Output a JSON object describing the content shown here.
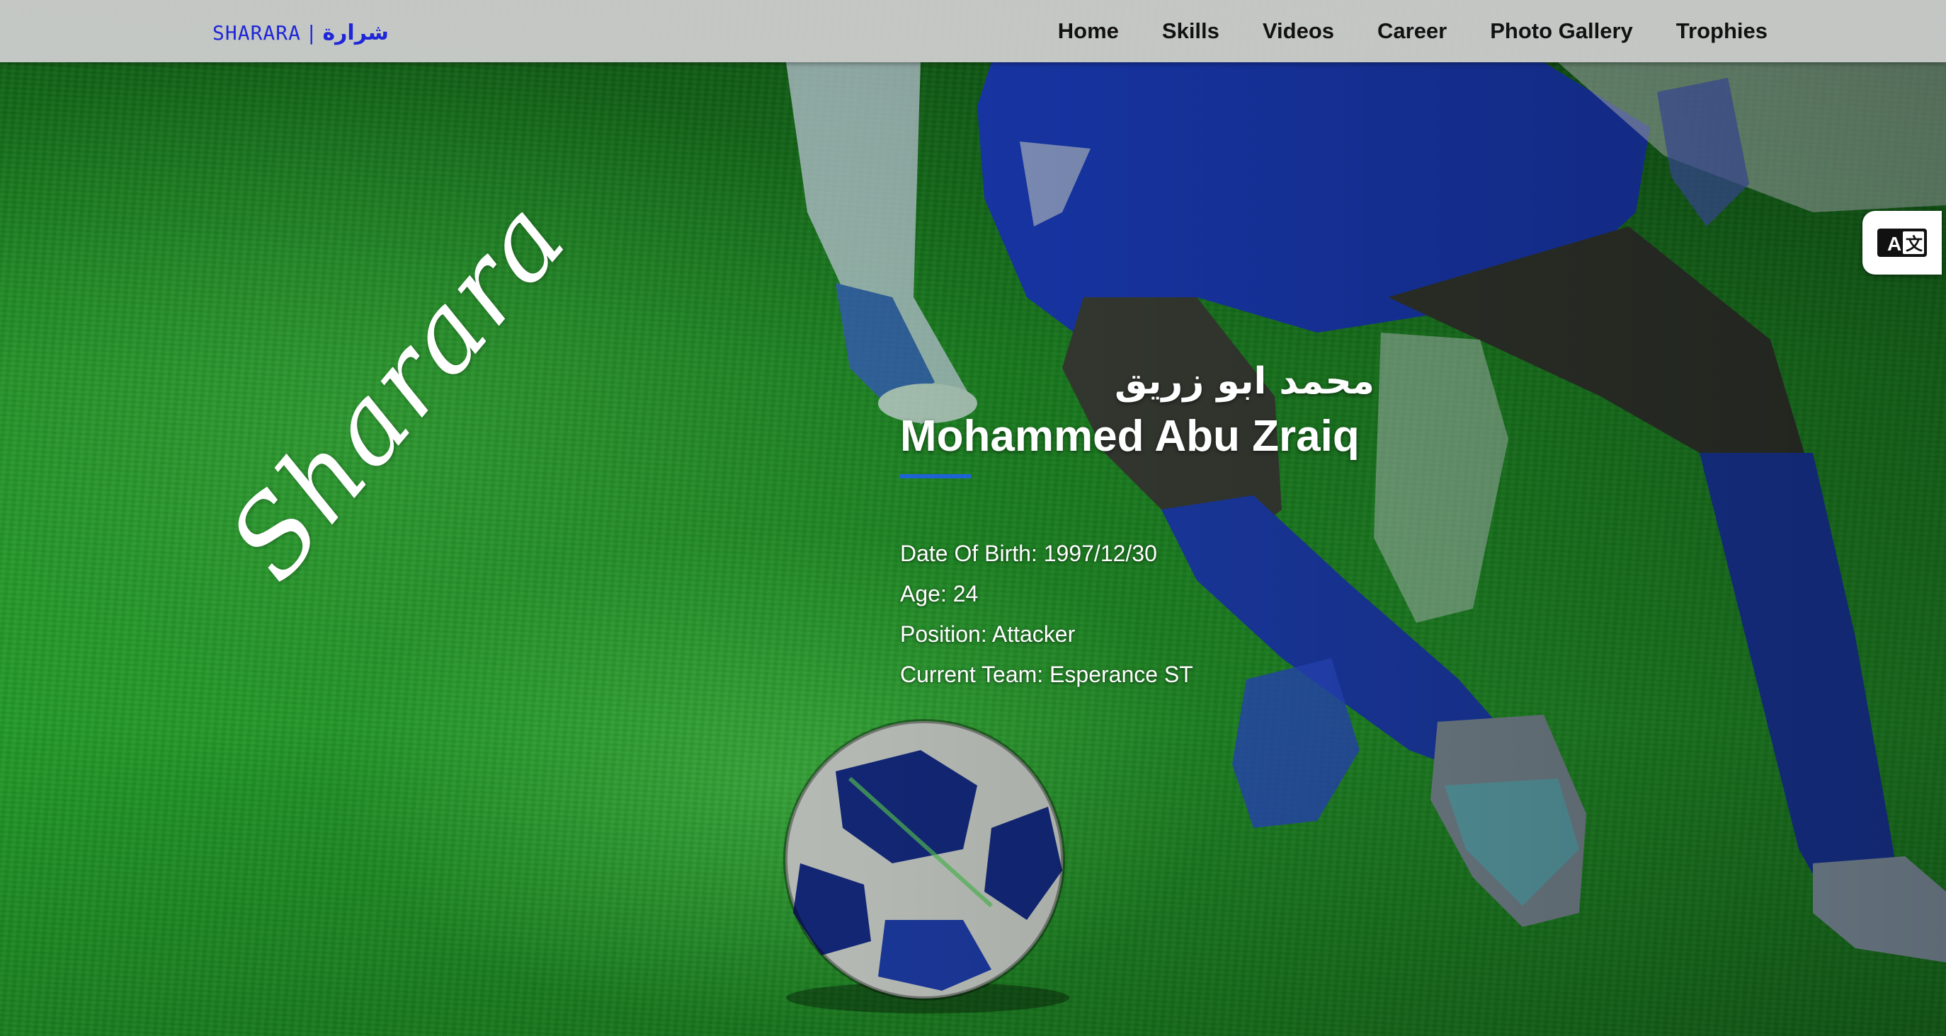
{
  "header": {
    "brand_latin": "SHARARA",
    "brand_separator": "|",
    "brand_arabic": "شرارة",
    "nav": [
      {
        "label": "Home"
      },
      {
        "label": "Skills"
      },
      {
        "label": "Videos"
      },
      {
        "label": "Career"
      },
      {
        "label": "Photo Gallery"
      },
      {
        "label": "Trophies"
      }
    ]
  },
  "translate_button": {
    "icon": "translate-icon"
  },
  "hero": {
    "script_word": "Sharara",
    "name_arabic": "محمد ابو زريق",
    "name_english": "Mohammed Abu Zraiq",
    "facts": [
      {
        "text": "Date Of Birth: 1997/12/30"
      },
      {
        "text": "Age: 24"
      },
      {
        "text": "Position: Attacker"
      },
      {
        "text": "Current Team: Esperance ST"
      }
    ]
  },
  "colors": {
    "nav_background": "#cdcdcd",
    "brand": "#1f25d8",
    "accent_underline": "#1e63d6",
    "grass": "#1c8a22"
  }
}
